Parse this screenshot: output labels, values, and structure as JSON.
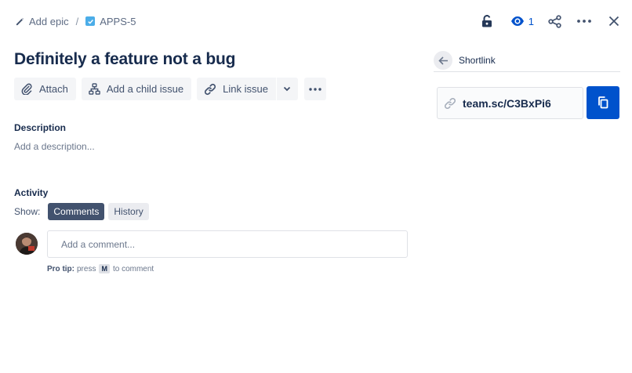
{
  "breadcrumb": {
    "epic_label": "Add epic",
    "separator": "/",
    "issue_key": "APPS-5"
  },
  "header": {
    "watch_count": "1"
  },
  "issue": {
    "title": "Definitely a feature not a bug"
  },
  "toolbar": {
    "attach_label": "Attach",
    "child_issue_label": "Add a child issue",
    "link_issue_label": "Link issue"
  },
  "description": {
    "label": "Description",
    "placeholder": "Add a description..."
  },
  "activity": {
    "label": "Activity",
    "show_label": "Show:",
    "filters": [
      "Comments",
      "History"
    ],
    "active_filter": "Comments",
    "comment_placeholder": "Add a comment...",
    "pro_tip_label": "Pro tip:",
    "pro_tip_press": "press",
    "pro_tip_key": "M",
    "pro_tip_suffix": "to comment"
  },
  "shortlink": {
    "title": "Shortlink",
    "url": "team.sc/C3BxPi6"
  },
  "colors": {
    "accent": "#0052cc",
    "story_icon": "#4bade8",
    "text": "#172b4d",
    "subtle": "#42526e"
  }
}
